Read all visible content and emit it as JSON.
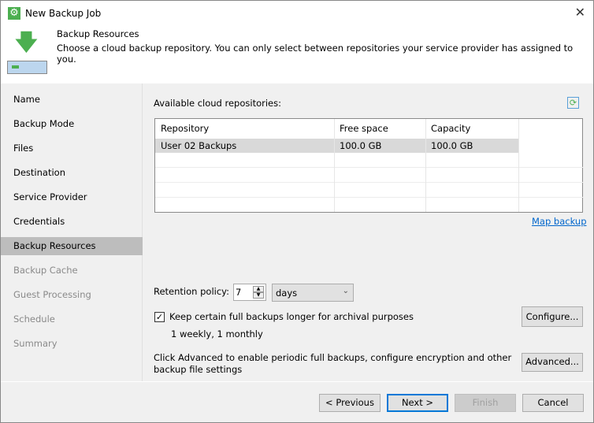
{
  "window": {
    "title": "New Backup Job"
  },
  "header": {
    "title": "Backup Resources",
    "description": "Choose a cloud backup repository. You can only select between repositories your service provider has assigned to you."
  },
  "sidebar": {
    "items": [
      {
        "label": "Name"
      },
      {
        "label": "Backup Mode"
      },
      {
        "label": "Files"
      },
      {
        "label": "Destination"
      },
      {
        "label": "Service Provider"
      },
      {
        "label": "Credentials"
      },
      {
        "label": "Backup Resources"
      },
      {
        "label": "Backup Cache"
      },
      {
        "label": "Guest Processing"
      },
      {
        "label": "Schedule"
      },
      {
        "label": "Summary"
      }
    ]
  },
  "main": {
    "repos_label": "Available cloud repositories:",
    "columns": [
      "Repository",
      "Free space",
      "Capacity"
    ],
    "rows": [
      [
        "User 02 Backups",
        "100.0 GB",
        "100.0 GB"
      ]
    ],
    "map_backup": "Map backup",
    "retention_label": "Retention policy:",
    "retention_value": "7",
    "retention_unit": "days",
    "archival_label": "Keep certain full backups longer for archival purposes",
    "archival_checked": true,
    "archival_summary": "1 weekly, 1 monthly",
    "configure": "Configure...",
    "advanced_text_1": "Click Advanced to enable periodic full backups, configure encryption and other",
    "advanced_text_2": "backup file settings",
    "advanced": "Advanced..."
  },
  "footer": {
    "previous": "< Previous",
    "next": "Next >",
    "finish": "Finish",
    "cancel": "Cancel"
  }
}
